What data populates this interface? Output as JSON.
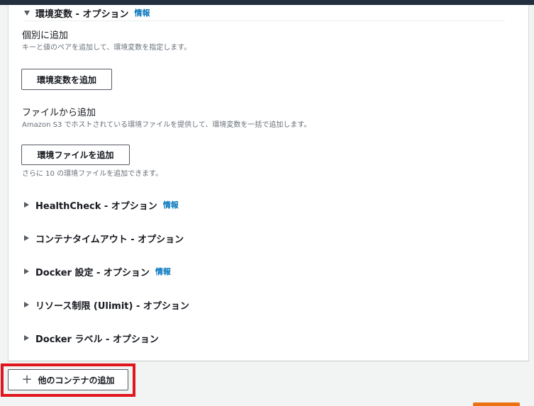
{
  "env_section": {
    "title": "環境変数 - オプション",
    "info": "情報",
    "individual": {
      "label": "個別に追加",
      "description": "キーと値のペアを追加して、環境変数を指定します。",
      "button": "環境変数を追加"
    },
    "file": {
      "label": "ファイルから追加",
      "description": "Amazon S3 でホストされている環境ファイルを提供して、環境変数を一括で追加します。",
      "button": "環境ファイルを追加",
      "remaining": "さらに 10 の環境ファイルを追加できます。"
    }
  },
  "sections": [
    {
      "title": "HealthCheck - オプション",
      "info": "情報"
    },
    {
      "title": "コンテナタイムアウト - オプション"
    },
    {
      "title": "Docker 設定 - オプション",
      "info": "情報"
    },
    {
      "title": "リソース制限 (Ulimit) - オプション"
    },
    {
      "title": "Docker ラベル - オプション"
    }
  ],
  "footer": {
    "add_container_button": "他のコンテナの追加",
    "add_icon": "plus-icon"
  },
  "colors": {
    "link": "#0073bb",
    "highlight": "#e0161e",
    "primary": "#ec7211"
  }
}
